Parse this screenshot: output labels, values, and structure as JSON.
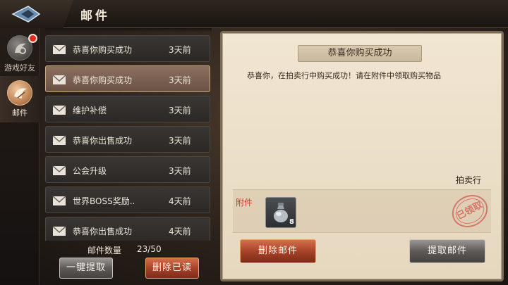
{
  "header": {
    "title": "邮件"
  },
  "tabs": [
    {
      "label": "游戏好友",
      "has_notification": true
    },
    {
      "label": "邮件",
      "active": true
    }
  ],
  "mails": [
    {
      "subject": "恭喜你购买成功",
      "age": "3天前"
    },
    {
      "subject": "恭喜你购买成功",
      "age": "3天前",
      "selected": true
    },
    {
      "subject": "维护补偿",
      "age": "3天前"
    },
    {
      "subject": "恭喜你出售成功",
      "age": "3天前"
    },
    {
      "subject": "公会升级",
      "age": "3天前"
    },
    {
      "subject": "世界BOSS奖励..",
      "age": "4天前"
    },
    {
      "subject": "恭喜你出售成功",
      "age": "4天前"
    }
  ],
  "mail_count": {
    "label": "邮件数量",
    "value": "23/50"
  },
  "buttons": {
    "claim_all": "一键提取",
    "delete_read": "删除已读",
    "delete_mail": "删除邮件",
    "claim_mail": "提取邮件"
  },
  "detail": {
    "title": "恭喜你购买成功",
    "body": "恭喜你，在拍卖行中购买成功！请在附件中领取购买物品",
    "sender": "拍卖行",
    "attachment_label": "附件",
    "attachment": {
      "icon": "potion-bag-icon",
      "count": "8"
    },
    "stamp": "已领取"
  },
  "colors": {
    "accent_red": "#a8422a",
    "stamp": "#d56a5c",
    "attach_label": "#cc3a2a"
  }
}
